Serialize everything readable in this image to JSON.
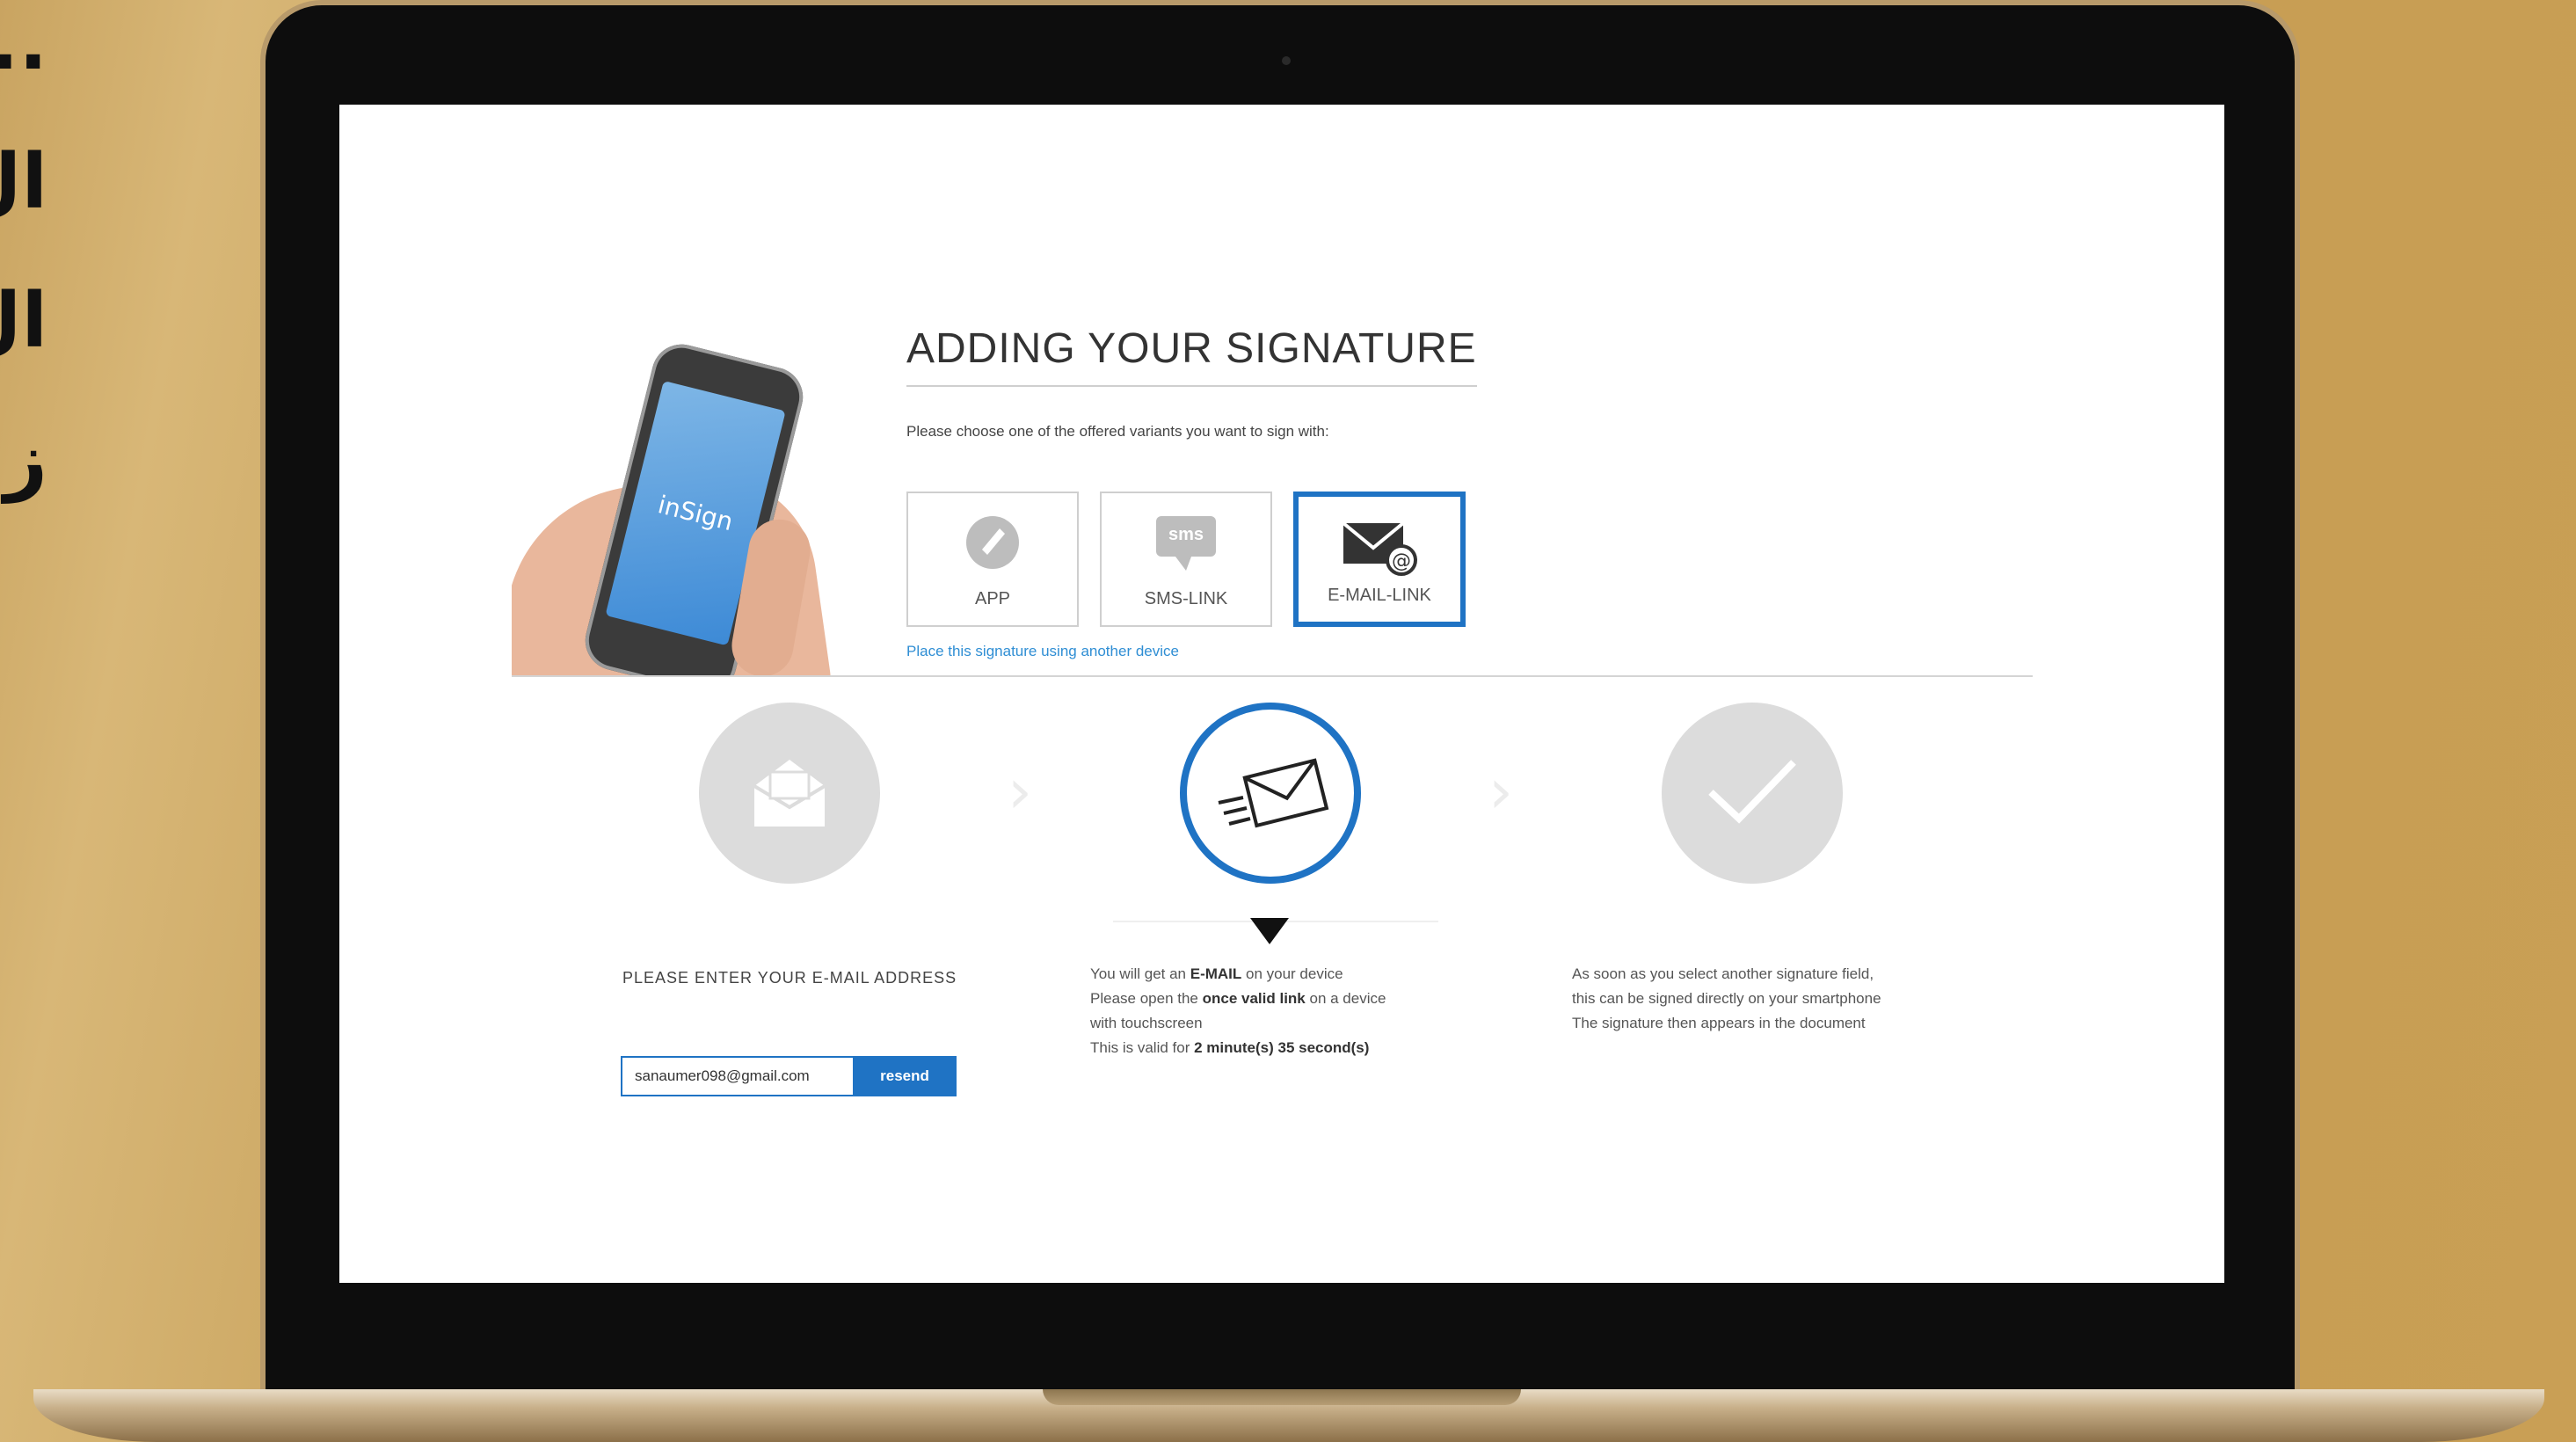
{
  "side_text": [
    "..",
    "ال",
    "ال",
    "ز"
  ],
  "page": {
    "title": "ADDING YOUR SIGNATURE",
    "subtitle": "Please choose one of the offered variants you want to sign with:",
    "phone_brand": "inSign"
  },
  "options": [
    {
      "label": "APP",
      "icon": "app-icon",
      "selected": false
    },
    {
      "label": "SMS-LINK",
      "icon": "sms-icon",
      "icon_text": "sms",
      "selected": false
    },
    {
      "label": "E-MAIL-LINK",
      "icon": "email-at-icon",
      "selected": true
    }
  ],
  "alt_link": "Place this signature using another device",
  "steps": {
    "step1": {
      "title": "PLEASE ENTER YOUR E-MAIL ADDRESS",
      "email_value": "sanaumer098@gmail.com",
      "resend_label": "resend"
    },
    "step2": {
      "line1_a": "You will get an ",
      "line1_b": "E-MAIL",
      "line1_c": " on your device",
      "line2_a": "Please open the ",
      "line2_b": "once valid link",
      "line2_c": " on a device",
      "line3": "with touchscreen",
      "line4_a": "This is valid for ",
      "line4_b": "2 minute(s) 35 second(s)"
    },
    "step3": {
      "line1": "As soon as you select another signature field,",
      "line2": "this can be signed directly on your smartphone",
      "line3": "The signature then appears in the document"
    }
  },
  "colors": {
    "accent": "#1f73c4",
    "background_gold": "#c69d52",
    "step_grey": "#dcdcdc"
  }
}
